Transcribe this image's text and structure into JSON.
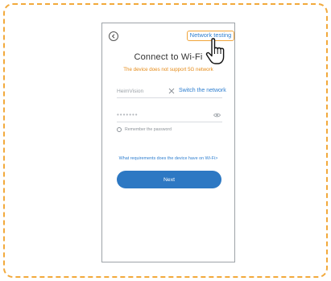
{
  "header": {
    "network_testing_label": "Network testing"
  },
  "page": {
    "title": "Connect to Wi-Fi",
    "warning": "The device does not support 5G network"
  },
  "form": {
    "ssid_value": "HeimVision",
    "switch_network_label": "Switch the network",
    "password_masked": "•••••••",
    "remember_label": "Remember the password",
    "requirements_link": "What requirements does the device have on Wi-Fi>",
    "next_label": "Next"
  },
  "colors": {
    "frame_border": "#f2a93b",
    "accent_blue": "#2d78c3",
    "link_blue": "#2f7fd0",
    "warning_orange": "#e58a16",
    "highlight_orange": "#f0a43a"
  },
  "icons": [
    "back-arrow-icon",
    "clear-icon",
    "eye-icon",
    "pointing-hand-icon"
  ]
}
